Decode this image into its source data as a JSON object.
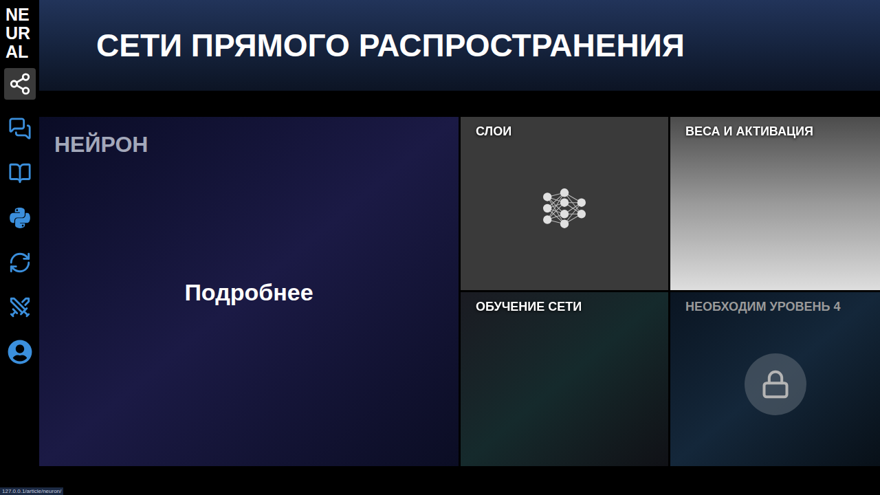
{
  "logo": [
    "NE",
    "UR",
    "AL"
  ],
  "sidebar": {
    "items": [
      {
        "selected": true
      },
      {
        "selected": false
      },
      {
        "selected": false
      },
      {
        "selected": false
      },
      {
        "selected": false
      },
      {
        "selected": false
      },
      {
        "selected": false
      }
    ]
  },
  "header": {
    "title": "СЕТИ ПРЯМОГО РАСПРОСТРАНЕНИЯ"
  },
  "tiles": [
    {
      "label": "НЕЙРОН",
      "kind": "feature",
      "action": "Подробнее",
      "locked": false
    },
    {
      "label": "СЛОИ",
      "kind": "layers",
      "locked": false
    },
    {
      "label": "ВЕСА И АКТИВАЦИЯ",
      "kind": "image",
      "locked": false
    },
    {
      "label": "ОБУЧЕНИЕ СЕТИ",
      "kind": "network",
      "locked": false
    },
    {
      "label": "НЕОБХОДИМ УРОВЕНЬ 4",
      "kind": "locked",
      "locked": true
    }
  ],
  "status_bar": {
    "url": "127.0.0.1/article/neuron/"
  }
}
